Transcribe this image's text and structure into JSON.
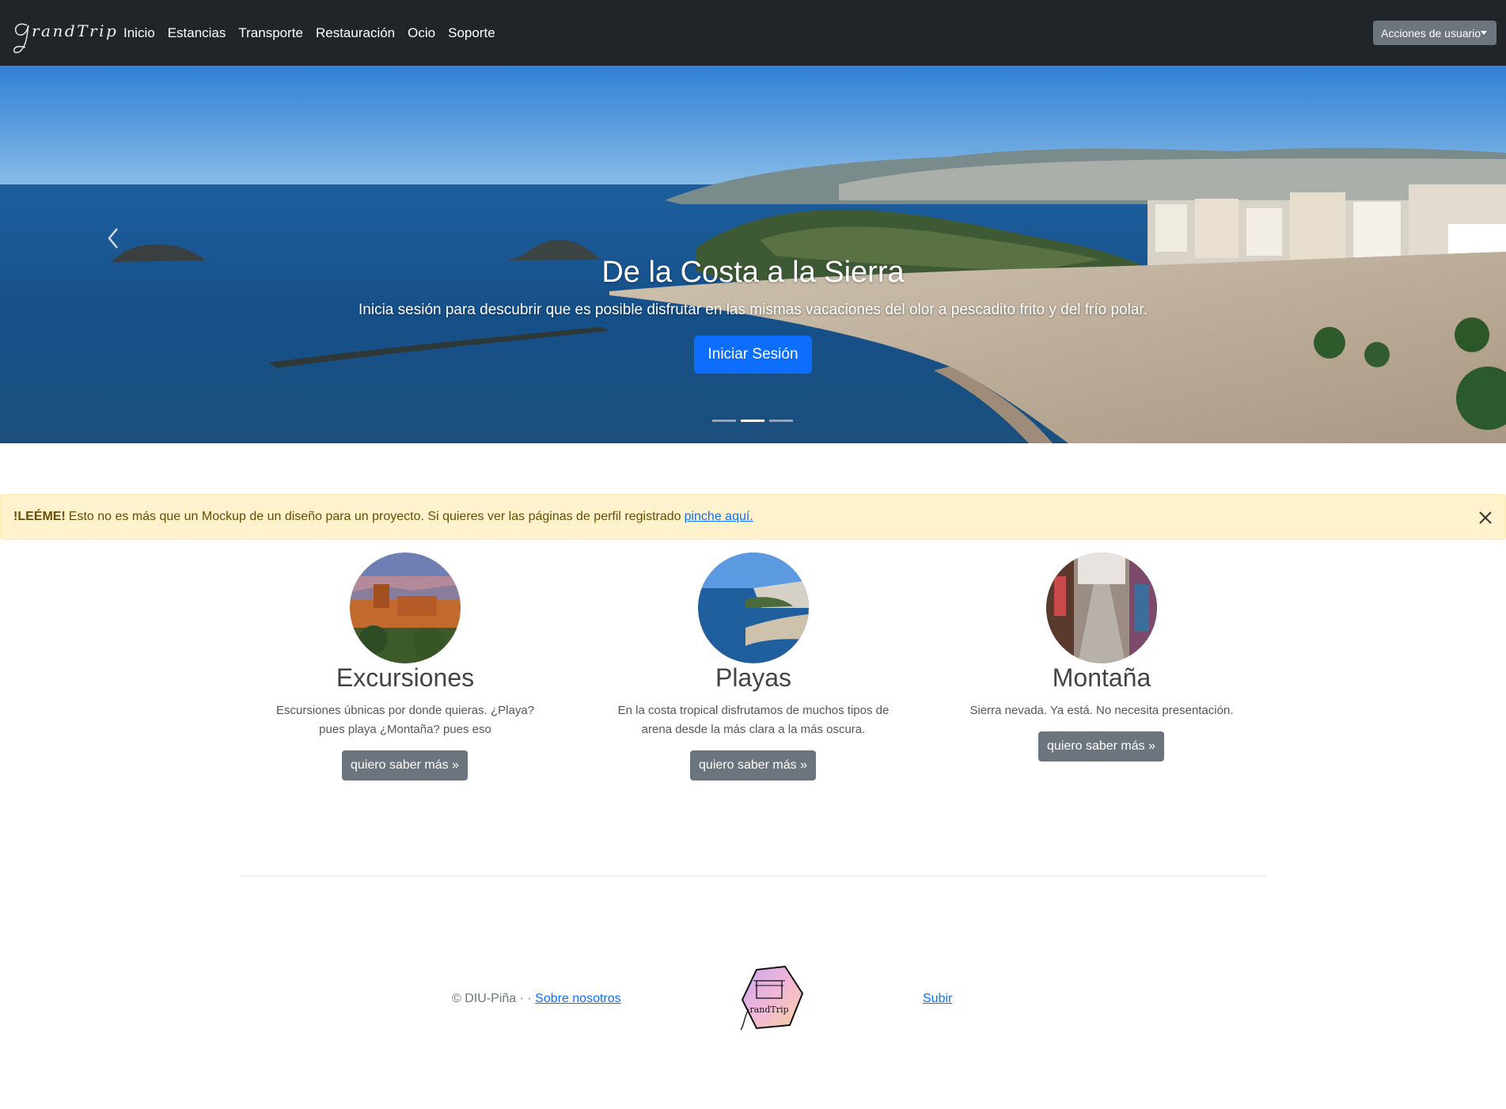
{
  "navbar": {
    "brand": "randTrip",
    "links": [
      "Inicio",
      "Estancias",
      "Transporte",
      "Restauración",
      "Ocio",
      "Soporte"
    ],
    "user_menu": "Acciones de usuario"
  },
  "hero": {
    "title": "De la Costa a la Sierra",
    "subtitle": "Inicia sesión para descubrir que es posible disfrutar en las mismas vacaciones del olor a pescadito frito y del frío polar.",
    "button": "Iniciar Sesión",
    "slides": 3,
    "active_slide": 2
  },
  "alert": {
    "strong": "!LEÉME!",
    "text": "Esto no es más que un Mockup de un diseño para un proyecto. Si quieres ver las páginas de perfil registrado",
    "link": "pinche aquí."
  },
  "features": [
    {
      "title": "Excursiones",
      "text": "Escursiones úbnicas por donde quieras. ¿Playa? pues playa ¿Montaña? pues eso",
      "button": "quiero saber más »"
    },
    {
      "title": "Playas",
      "text": "En la costa tropical disfrutamos de muchos tipos de arena desde la más clara a la más oscura.",
      "button": "quiero saber más »"
    },
    {
      "title": "Montaña",
      "text": "Sierra nevada. Ya está. No necesita presentación.",
      "button": "quiero saber más »"
    }
  ],
  "footer": {
    "copyright": "© DIU-Piña · ·",
    "about_link": "Sobre nosotros",
    "logo_text": "randTrip",
    "top_link": "Subir"
  },
  "colors": {
    "navbar": "#212529",
    "primary": "#0d6efd",
    "secondary": "#6c757d",
    "alert_bg": "#fff3cd"
  }
}
